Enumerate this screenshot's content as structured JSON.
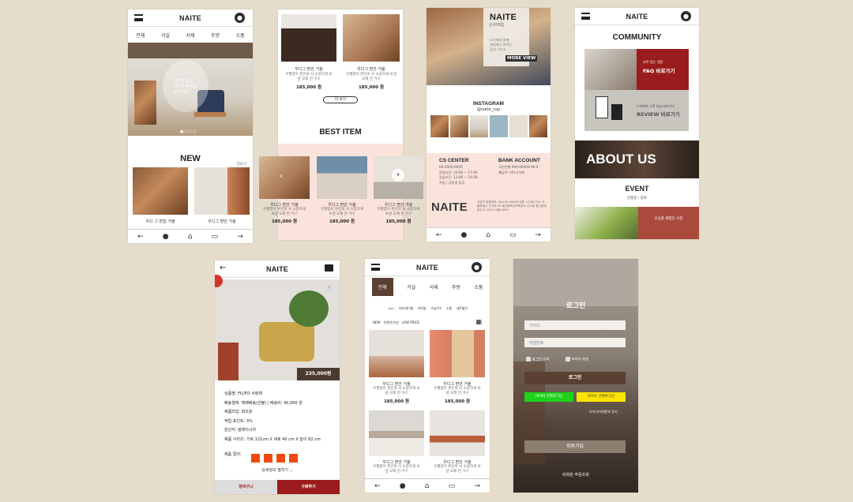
{
  "brand": "NAITE",
  "nav_tabs": [
    "전체",
    "거실",
    "서재",
    "주방",
    "소품"
  ],
  "icons": {
    "menu": "hamburger-icon",
    "user": "user-icon",
    "back": "arrow-left-icon",
    "chat": "chat-icon",
    "home": "home-icon",
    "cart": "cart-icon",
    "forward": "arrow-right-icon",
    "next": "chevron-right-icon",
    "prev": "chevron-left-icon",
    "share": "share-icon",
    "grid": "grid-icon"
  },
  "colors": {
    "accent": "#9b1c1c",
    "brown": "#5a4033",
    "pink": "#fbe3dc",
    "naver": "#03c75a",
    "kakao": "#fee500"
  },
  "s1": {
    "hero_caption": [
      "당신의 감성",
      "편안한 휴식을",
      "모두에게"
    ],
    "new_title": "NEW",
    "more": "더보기",
    "items": [
      {
        "name": "우디 그 편집 가볼"
      },
      {
        "name": "우디그 편안 거울"
      }
    ]
  },
  "s2": {
    "items": [
      {
        "name": "우디그 편안 거울",
        "desc": "우월함이 본인의 사 소중하게 보낸 오래 전 가구",
        "price": "185,000 원"
      },
      {
        "name": "우디그 편안 거울",
        "desc": "우월함이 본인의 사 소중하게 보낸 오래 전 가구",
        "price": "185,000 원"
      }
    ],
    "more_button": "더 보기",
    "best_title": "BEST ITEM",
    "best_items": [
      {
        "name": "우디그 편안 거울",
        "desc": "우월함이 본인의 사 소중하게 보낸 오래 전 가구",
        "price": "185,000 원"
      },
      {
        "name": "우디그 편안 거울",
        "desc": "우월함이 본인의 사 소중하게 보낸 오래 전 가구",
        "price": "185,000 원"
      },
      {
        "name": "우디그 편안 거울",
        "desc": "우월함이 본인의 사 소중하게 보낸 오래 전 가구",
        "price": "185,000 원"
      }
    ]
  },
  "s3": {
    "brand_sub": "[나이테]",
    "intro": [
      "나이테와 함께",
      "계절마다 바뀌는",
      "감성 그리고"
    ],
    "more_view": "MORE VIEW",
    "instagram_title": "INSTAGRAM",
    "instagram_handle": "@naite_cop",
    "cs_title": "CS CENTER",
    "cs_lines": [
      "00-0000-0000",
      "운영시간: 10:00 ~ 17:00",
      "점심시간: 12:00 ~ 14:00",
      "주말 / 공휴일 휴무"
    ],
    "bank_title": "BANK ACCOUNT",
    "bank_lines": [
      "국민은행 000-00000-00-0",
      "예금주: (주)나이테"
    ],
    "footer_logo": "NAITE",
    "footer_info": "사업자 등록번호: 000-00-00000 대표: 나이테 주소: 서울특별시 가구로 00 개인정보관리책임자: 나이테 통신판매업신고: 2021-서울-0000"
  },
  "s4": {
    "community_title": "COMMUNITY",
    "faq": [
      "자주 묻는 질문",
      "FAQ 바로가기"
    ],
    "review": [
      "나이테의 고객 리뷰 바로가기",
      "REVIEW 바로가기"
    ],
    "about": "ABOUT US",
    "event_title": "EVENT",
    "event_tabs": [
      "진행중",
      "종료"
    ],
    "event_caption": "신상품 체험단 모집"
  },
  "s5": {
    "price": "235,000원",
    "specs": [
      "상품명: FILIFO 사정체",
      "배송형태: 택배배송(선불)  |  배송비: 40,000 원",
      "제품타입: 화조원",
      "적립 포인트: 3%",
      "원산지: 말레이시아",
      "제품 사이즈: 가로 121cm X 세로 40 cm X 높이 82 cm"
    ],
    "color_label": "제품 컬러:",
    "color_count": 4,
    "detail_link": "상세정보 펼치기",
    "cart_button": "장바구니",
    "buy_button": "구매하기"
  },
  "s6": {
    "sub_tabs": [
      "ALL",
      "의자/테이블",
      "테이블",
      "수납가구",
      "소품",
      "세트할인"
    ],
    "sort": [
      "NEW",
      "추천/인기순",
      "LOW PRICE"
    ],
    "products": [
      {
        "name": "우디그 편안 거울",
        "desc": "우월함이 본인의 사 소중하게 보낸 오래 전 가구",
        "price": "185,000 원"
      },
      {
        "name": "우디그 편안 거울",
        "desc": "우월함이 본인의 사 소중하게 보낸 오래 전 가구",
        "price": "185,000 원"
      },
      {
        "name": "우디그 편안 거울",
        "desc": "우월함이 본인의 사 소중하게 보낸 오래 전 가구",
        "price": "185,000 원"
      },
      {
        "name": "우디그 편안 거울",
        "desc": "우월함이 본인의 사 소중하게 보낸 오래 전 가구",
        "price": "185,000 원"
      }
    ]
  },
  "s7": {
    "title": "로그인",
    "id_placeholder": "아이디",
    "pw_placeholder": "비밀번호",
    "auto_login": "로그인 유지",
    "save_id": "아이디 저장",
    "login_button": "로그인",
    "naver": "네이버 간편로그인",
    "kakao": "카카오 간편로그인",
    "find": "아이디/비밀번호 찾기",
    "join": "회원가입",
    "guest": "비회원 주문조회"
  }
}
